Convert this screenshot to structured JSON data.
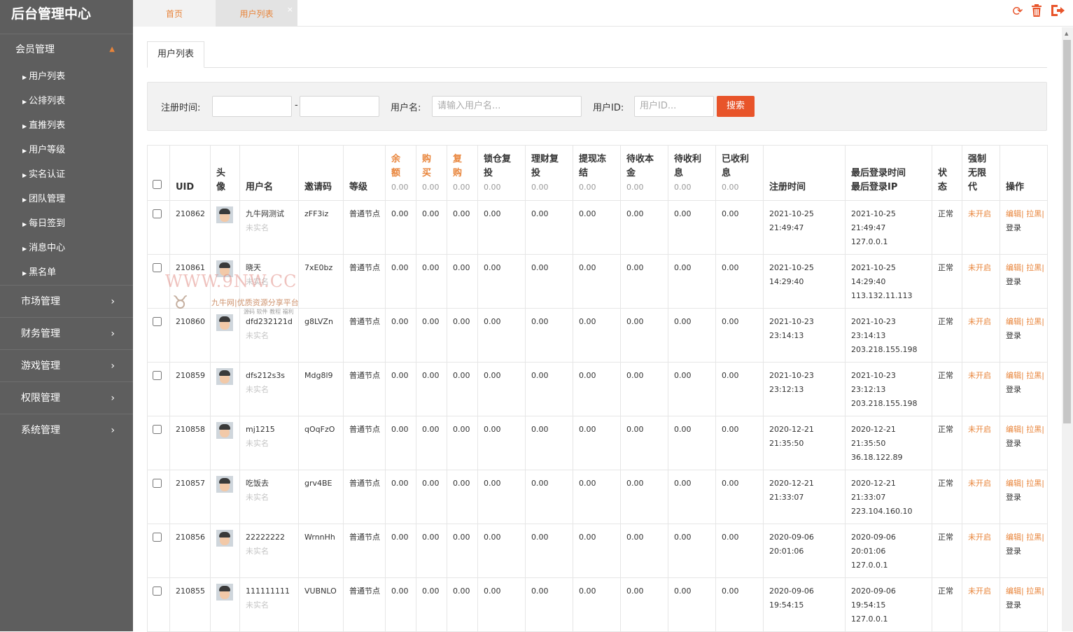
{
  "brand": "后台管理中心",
  "sidebar": {
    "open_group": "会员管理",
    "sub_items": [
      "用户列表",
      "公排列表",
      "直推列表",
      "用户等级",
      "实名认证",
      "团队管理",
      "每日签到",
      "消息中心",
      "黑名单"
    ],
    "groups": [
      "市场管理",
      "财务管理",
      "游戏管理",
      "权限管理",
      "系统管理"
    ]
  },
  "tabs": {
    "home": "首页",
    "users": "用户列表",
    "close": "×"
  },
  "content_tab": "用户列表",
  "search": {
    "reg_time_label": "注册时间:",
    "dash": "-",
    "username_label": "用户名:",
    "username_placeholder": "请输入用户名...",
    "uid_label": "用户ID:",
    "uid_placeholder": "用户ID...",
    "button": "搜索"
  },
  "table": {
    "headers": {
      "uid": "UID",
      "avatar": "头像",
      "username": "用户名",
      "invite": "邀请码",
      "level": "等级",
      "balance": "余额",
      "buy": "购买",
      "rebuy": "复购",
      "lock": "锁仓复投",
      "finance": "理财复投",
      "withdraw": "提现冻结",
      "pending_principal": "待收本金",
      "pending_interest": "待收利息",
      "received_interest": "已收利息",
      "reg_time": "注册时间",
      "last_login_time": "最后登录时间",
      "last_login_ip": "最后登录IP",
      "status": "状态",
      "force": "强制无限代",
      "ops": "操作"
    },
    "header_sums": {
      "balance": "0.00",
      "buy": "0.00",
      "rebuy": "0.00",
      "lock": "0.00",
      "finance": "0.00",
      "withdraw": "0.00",
      "pending_principal": "0.00",
      "pending_interest": "0.00",
      "received_interest": "0.00"
    },
    "rows": [
      {
        "uid": "210862",
        "name": "九牛网测试",
        "real": "未实名",
        "invite": "zFF3iz",
        "level": "普通节点",
        "balance": "0.00",
        "buy": "0.00",
        "rebuy": "0.00",
        "lock": "0.00",
        "finance": "0.00",
        "withdraw": "0.00",
        "pp": "0.00",
        "pi": "0.00",
        "ri": "0.00",
        "reg_date": "2021-10-25",
        "reg_time": "21:49:47",
        "login_date": "2021-10-25",
        "login_time": "21:49:47",
        "ip": "127.0.0.1",
        "status": "正常",
        "force": "未开启",
        "edit": "编辑|",
        "ban": "拉黑|",
        "logout": "登录"
      },
      {
        "uid": "210861",
        "name": "晓天",
        "real": "未实名",
        "invite": "7xE0bz",
        "level": "普通节点",
        "balance": "0.00",
        "buy": "0.00",
        "rebuy": "0.00",
        "lock": "0.00",
        "finance": "0.00",
        "withdraw": "0.00",
        "pp": "0.00",
        "pi": "0.00",
        "ri": "0.00",
        "reg_date": "2021-10-25",
        "reg_time": "14:29:40",
        "login_date": "2021-10-25",
        "login_time": "14:29:40",
        "ip": "113.132.11.113",
        "status": "正常",
        "force": "未开启",
        "edit": "编辑|",
        "ban": "拉黑|",
        "logout": "登录"
      },
      {
        "uid": "210860",
        "name": "dfd232121d",
        "real": "未实名",
        "invite": "g8LVZn",
        "level": "普通节点",
        "balance": "0.00",
        "buy": "0.00",
        "rebuy": "0.00",
        "lock": "0.00",
        "finance": "0.00",
        "withdraw": "0.00",
        "pp": "0.00",
        "pi": "0.00",
        "ri": "0.00",
        "reg_date": "2021-10-23",
        "reg_time": "23:14:13",
        "login_date": "2021-10-23",
        "login_time": "23:14:13",
        "ip": "203.218.155.198",
        "status": "正常",
        "force": "未开启",
        "edit": "编辑|",
        "ban": "拉黑|",
        "logout": "登录"
      },
      {
        "uid": "210859",
        "name": "dfs212s3s",
        "real": "未实名",
        "invite": "Mdg8l9",
        "level": "普通节点",
        "balance": "0.00",
        "buy": "0.00",
        "rebuy": "0.00",
        "lock": "0.00",
        "finance": "0.00",
        "withdraw": "0.00",
        "pp": "0.00",
        "pi": "0.00",
        "ri": "0.00",
        "reg_date": "2021-10-23",
        "reg_time": "23:12:13",
        "login_date": "2021-10-23",
        "login_time": "23:12:13",
        "ip": "203.218.155.198",
        "status": "正常",
        "force": "未开启",
        "edit": "编辑|",
        "ban": "拉黑|",
        "logout": "登录"
      },
      {
        "uid": "210858",
        "name": "mj1215",
        "real": "未实名",
        "invite": "qOqFzO",
        "level": "普通节点",
        "balance": "0.00",
        "buy": "0.00",
        "rebuy": "0.00",
        "lock": "0.00",
        "finance": "0.00",
        "withdraw": "0.00",
        "pp": "0.00",
        "pi": "0.00",
        "ri": "0.00",
        "reg_date": "2020-12-21",
        "reg_time": "21:35:50",
        "login_date": "2020-12-21",
        "login_time": "21:35:50",
        "ip": "36.18.122.89",
        "status": "正常",
        "force": "未开启",
        "edit": "编辑|",
        "ban": "拉黑|",
        "logout": "登录"
      },
      {
        "uid": "210857",
        "name": "吃饭去",
        "real": "未实名",
        "invite": "grv4BE",
        "level": "普通节点",
        "balance": "0.00",
        "buy": "0.00",
        "rebuy": "0.00",
        "lock": "0.00",
        "finance": "0.00",
        "withdraw": "0.00",
        "pp": "0.00",
        "pi": "0.00",
        "ri": "0.00",
        "reg_date": "2020-12-21",
        "reg_time": "21:33:07",
        "login_date": "2020-12-21",
        "login_time": "21:33:07",
        "ip": "223.104.160.10",
        "status": "正常",
        "force": "未开启",
        "edit": "编辑|",
        "ban": "拉黑|",
        "logout": "登录"
      },
      {
        "uid": "210856",
        "name": "22222222",
        "real": "未实名",
        "invite": "WrnnHh",
        "level": "普通节点",
        "balance": "0.00",
        "buy": "0.00",
        "rebuy": "0.00",
        "lock": "0.00",
        "finance": "0.00",
        "withdraw": "0.00",
        "pp": "0.00",
        "pi": "0.00",
        "ri": "0.00",
        "reg_date": "2020-09-06",
        "reg_time": "20:01:06",
        "login_date": "2020-09-06",
        "login_time": "20:01:06",
        "ip": "127.0.0.1",
        "status": "正常",
        "force": "未开启",
        "edit": "编辑|",
        "ban": "拉黑|",
        "logout": "登录"
      },
      {
        "uid": "210855",
        "name": "111111111",
        "real": "未实名",
        "invite": "VUBNLO",
        "level": "普通节点",
        "balance": "0.00",
        "buy": "0.00",
        "rebuy": "0.00",
        "lock": "0.00",
        "finance": "0.00",
        "withdraw": "0.00",
        "pp": "0.00",
        "pi": "0.00",
        "ri": "0.00",
        "reg_date": "2020-09-06",
        "reg_time": "19:54:15",
        "login_date": "2020-09-06",
        "login_time": "19:54:15",
        "ip": "127.0.0.1",
        "status": "正常",
        "force": "未开启",
        "edit": "编辑|",
        "ban": "拉黑|",
        "logout": "登录"
      }
    ]
  },
  "watermark": {
    "url": "WWW.9NW.CC",
    "name": "九牛网|优质资源分享平台",
    "tagline": "源码 软件 教程 福利"
  },
  "colors": {
    "accent": "#e8843a",
    "button": "#e8542a",
    "sidebar": "#5e5e5e"
  },
  "icons": [
    "refresh-icon",
    "trash-icon",
    "logout-icon"
  ]
}
